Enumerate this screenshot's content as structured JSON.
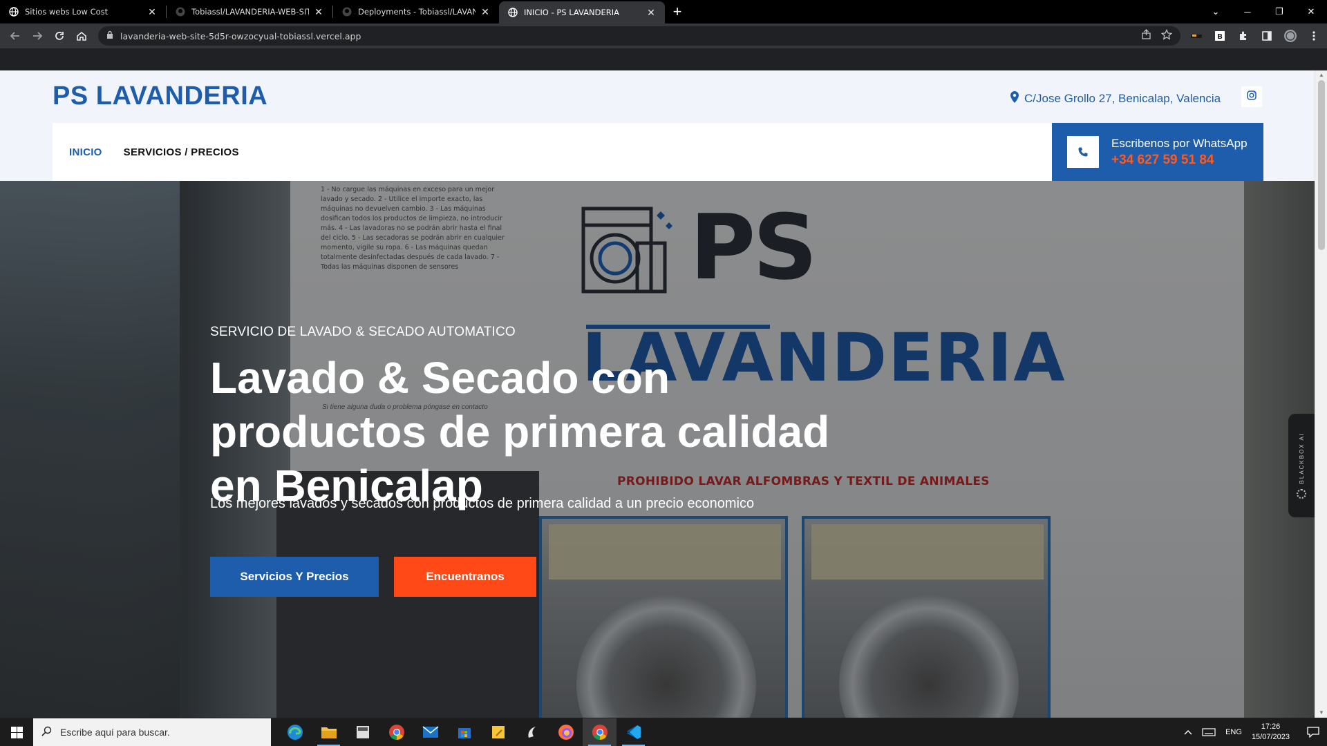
{
  "browser": {
    "tabs": [
      {
        "title": "Sitios webs Low Cost",
        "icon": "globe-icon"
      },
      {
        "title": "Tobiassl/LAVANDERIA-WEB-SITE",
        "icon": "github-icon"
      },
      {
        "title": "Deployments - Tobiassl/LAVANDE",
        "icon": "github-icon"
      },
      {
        "title": "INICIO - PS LAVANDERIA",
        "icon": "globe-icon",
        "active": true
      }
    ],
    "url": "lavanderia-web-site-5d5r-owzocyual-tobiassl.vercel.app"
  },
  "site": {
    "logo": "PS LAVANDERIA",
    "address": "C/Jose Grollo 27, Benicalap, Valencia",
    "nav": [
      {
        "label": "INICIO",
        "active": true
      },
      {
        "label": "SERVICIOS / PRECIOS",
        "active": false
      }
    ],
    "whatsapp": {
      "title": "Escribenos por WhatsApp",
      "number": "+34 627 59 51 84"
    },
    "hero": {
      "kicker": "SERVICIO DE LAVADO & SECADO AUTOMATICO",
      "headline": "Lavado & Secado con productos de primera calidad en Benicalap",
      "subtext": "Los mejores lavados y secados con productos de primera calidad a un precio economico",
      "btn_primary": "Servicios Y Precios",
      "btn_secondary": "Encuentranos",
      "photo": {
        "rules": "1 - No cargue las máquinas en exceso para un mejor lavado y secado. 2 - Utilice el importe exacto, las máquinas no devuelven cambio. 3 - Las máquinas dosifican todos los productos de limpieza, no introducir más. 4 - Las lavadoras no se podrán abrir hasta el final del ciclo. 5 - Las secadoras se podrán abrir en cualquier momento, vigile su ropa. 6 - Las máquinas quedan totalmente desinfectadas después de cada lavado. 7 - Todas las máquinas disponen de sensores",
        "sign_ps": "PS",
        "sign_lavanderia": "LAVANDERIA",
        "contact_note": "Si tiene alguna duda o problema póngase en contacto",
        "prohibited": "PROHIBIDO LAVAR ALFOMBRAS Y TEXTIL DE ANIMALES"
      }
    },
    "sidebar_widget": "BLACKBOX AI"
  },
  "taskbar": {
    "search_placeholder": "Escribe aquí para buscar.",
    "language": "ENG",
    "time": "17:26",
    "date": "15/07/2023"
  },
  "colors": {
    "brand_blue": "#1d5dac",
    "accent_orange": "#ff4a17"
  }
}
